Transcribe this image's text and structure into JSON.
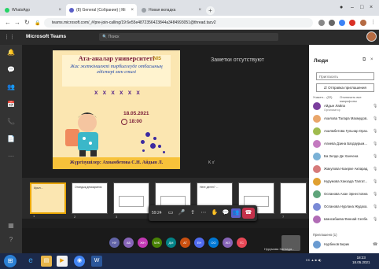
{
  "browser": {
    "tabs": [
      {
        "label": "WhatsApp",
        "color": "#25d366"
      },
      {
        "label": "(8) General (Собрание) | Mi",
        "color": "#5b5fc7"
      },
      {
        "label": "Новая вкладка",
        "color": "#888888"
      }
    ],
    "new_tab": "+",
    "address": "teams.microsoft.com/_#/pre-join-calling/19:6e55e4872356423844a3484993051@thread.tacv2"
  },
  "teams": {
    "title": "Microsoft Teams",
    "search_placeholder": "Поиск"
  },
  "slide": {
    "title": "Ата-аналар университеті",
    "logo": "NIS",
    "subtitle": "Жас жеткіншекті тәрбиелеуде отбасының әдістері мен стилі",
    "marks": "x x x x x x",
    "date": "18.05.2021",
    "time": "18:00",
    "speakers": "Жүргізушілер: Ахнамбетова С.Н. Айдын Л."
  },
  "notes_text": "Заметки отсутствуют",
  "kk_text": "K  x'",
  "thumbnails": [
    {
      "num": "1",
      "label": "Ауыл...",
      "selected": true
    },
    {
      "num": "2",
      "label": "Отандық демократия",
      "selected": false
    },
    {
      "num": "3",
      "label": "",
      "selected": false
    },
    {
      "num": "4",
      "label": "",
      "selected": false
    },
    {
      "num": "5",
      "label": "Неге деген? ...",
      "selected": false
    },
    {
      "num": "6",
      "label": "",
      "selected": false
    },
    {
      "num": "7",
      "label": "",
      "selected": false
    }
  ],
  "controls": {
    "timer": "59:24"
  },
  "participants_strip": {
    "circles": [
      {
        "text": "НУ",
        "color": "#6264a7"
      },
      {
        "text": "АБ",
        "color": "#8764b8"
      },
      {
        "text": "ЖН",
        "color": "#c239b3"
      },
      {
        "text": "МЖ",
        "color": "#498205"
      },
      {
        "text": "ДМ",
        "color": "#038387"
      },
      {
        "text": "АТ",
        "color": "#ca5010"
      },
      {
        "text": "ЕН",
        "color": "#4f6bed"
      },
      {
        "text": "ОО",
        "color": "#0078d4"
      },
      {
        "text": "ЖЗ",
        "color": "#8764b8"
      },
      {
        "text": "ГС",
        "color": "#e74856"
      }
    ],
    "speaker_name": "Нурумова Ханзада..."
  },
  "people": {
    "title": "Люди",
    "invite_placeholder": "Пригласить",
    "share_button": "Отправка приглашения",
    "section": "Участн... (22)",
    "mute_all": "Отключить все микрофоны",
    "list": [
      {
        "name": "Айдын Лайла",
        "sub": "Организатор",
        "color": "#7a3e9d"
      },
      {
        "name": "Ахилова Талара Махмудов...",
        "sub": "",
        "color": "#e9a66a"
      },
      {
        "name": "Ахилмбетова Гульнар Ораз...",
        "sub": "",
        "color": "#9fbb4d"
      },
      {
        "name": "Алиева Дзина Багдаурым...",
        "sub": "",
        "color": "#c47ac0"
      },
      {
        "name": "Ба Зелде Де Ханчена",
        "sub": "",
        "color": "#7ab1d6"
      },
      {
        "name": "Жакупова Назерке Акпарад...",
        "sub": "",
        "color": "#d67a7a"
      },
      {
        "name": "Нурумова Ханзада Талгат...",
        "sub": "",
        "color": "#e0a030"
      },
      {
        "name": "Оспанова Ахан Эрнестовна",
        "sub": "",
        "color": "#5fa47a"
      },
      {
        "name": "Оспанова Нурлана Жудаха...",
        "sub": "",
        "color": "#7a8ad6"
      },
      {
        "name": "Шансабаева Финнай Селбе...",
        "sub": "",
        "color": "#b06bb5"
      }
    ],
    "invited_label": "Приглашено (1)",
    "invited": [
      {
        "name": "Нурбеков Берик",
        "sub": "",
        "color": "#6a9bd1"
      }
    ]
  },
  "taskbar": {
    "tray": "KK ▲ ■ ◀)",
    "time": "18:23",
    "date": "18.05.2021"
  }
}
